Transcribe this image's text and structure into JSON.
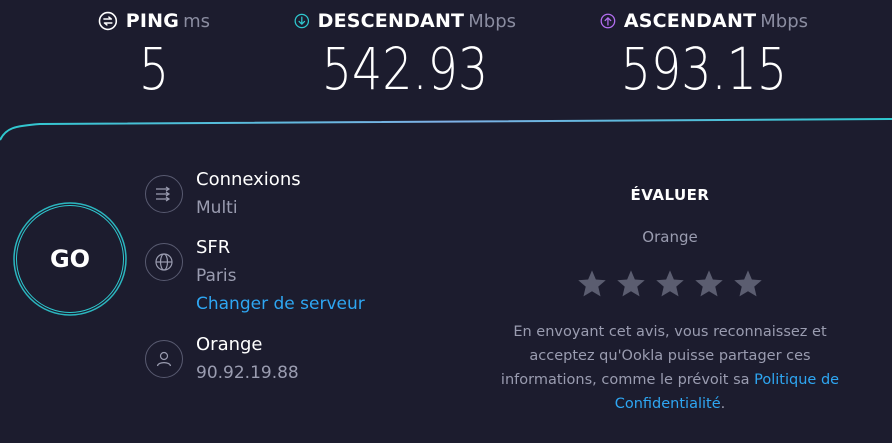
{
  "metrics": {
    "ping": {
      "label": "PING",
      "unit": "ms",
      "value": "5",
      "icon": "ping-icon"
    },
    "download": {
      "label": "DESCENDANT",
      "unit": "Mbps",
      "value": "542.93",
      "icon": "download-arrow-icon"
    },
    "upload": {
      "label": "ASCENDANT",
      "unit": "Mbps",
      "value": "593.15",
      "icon": "upload-arrow-icon"
    }
  },
  "colors": {
    "background": "#1c1c2e",
    "accent_cyan": "#2ec8cf",
    "upload_purple": "#b36ef0",
    "link": "#2ea6f2",
    "muted": "#9a9cb0"
  },
  "go_button": {
    "label": "GO"
  },
  "connections": {
    "title": "Connexions",
    "value": "Multi"
  },
  "server": {
    "title": "SFR",
    "location": "Paris",
    "change_link": "Changer de serveur"
  },
  "provider": {
    "title": "Orange",
    "ip": "90.92.19.88"
  },
  "rating": {
    "title": "ÉVALUER",
    "isp": "Orange",
    "stars": 5,
    "note_text": "En envoyant cet avis, vous reconnaissez et acceptez qu'Ookla puisse partager ces informations, comme le prévoit sa",
    "policy_link": "Politique de Confidentialité",
    "note_end": "."
  }
}
